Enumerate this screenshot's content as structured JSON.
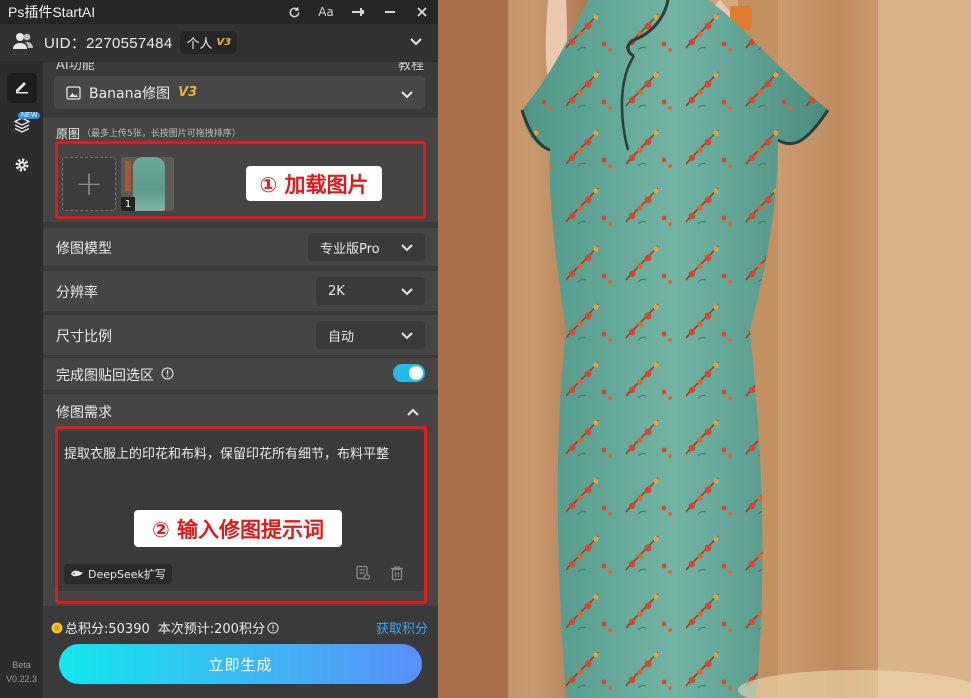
{
  "titlebar": {
    "title": "Ps插件StartAI",
    "icons": [
      "refresh-icon",
      "font-size-icon",
      "pin-icon",
      "minimize-icon",
      "close-icon"
    ],
    "font_label": "Aa"
  },
  "user": {
    "uid": "UID：2270557484",
    "plan": "个人",
    "plan_version": "V3"
  },
  "sidebar": {
    "new_tag": "NEW",
    "beta": "Beta",
    "version": "V0.22.3"
  },
  "section": {
    "partial_left": "AI功能",
    "partial_right": "教程"
  },
  "feature": {
    "name": "Banana修图",
    "version": "V3"
  },
  "upload": {
    "label": "原图",
    "hint": "（最多上传5张，长按图片可拖拽排序）",
    "add_symbol": "+",
    "thumb_index": "1",
    "callout": "① 加载图片"
  },
  "settings": [
    {
      "label": "修图模型",
      "value": "专业版Pro"
    },
    {
      "label": "分辨率",
      "value": "2K"
    },
    {
      "label": "尺寸比例",
      "value": "自动"
    }
  ],
  "paste_back": {
    "label": "完成图贴回选区",
    "enabled": true
  },
  "prompt": {
    "label": "修图需求",
    "text": "提取衣服上的印花和布料，保留印花所有细节，布料平整",
    "callout": "② 输入修图提示词",
    "deepseek": "DeepSeek扩写"
  },
  "footer": {
    "points": "总积分:50390",
    "estimate": "本次预计:200积分",
    "get_points": "获取积分",
    "generate": "立即生成"
  },
  "colors": {
    "accent": "#22bce8",
    "highlight_red": "#e21a1a",
    "v3_gold": "#e8b43a",
    "link_blue": "#3aa6f0",
    "dress_green": "#5fa89a",
    "flower_red": "#d9452e"
  }
}
